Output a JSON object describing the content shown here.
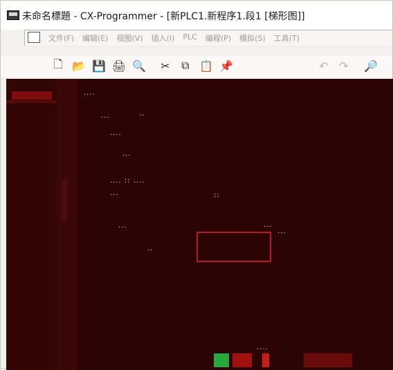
{
  "window": {
    "title": "未命名標題 - CX-Programmer - [新PLC1.新程序1.段1 [梯形图]]",
    "app_icon": "ladder-app-icon"
  },
  "menubar": {
    "items": [
      "文件(F)",
      "编辑(E)",
      "视图(V)",
      "插入(I)",
      "PLC",
      "编程(P)",
      "模拟(S)",
      "工具(T)"
    ]
  },
  "toolbar": {
    "buttons": [
      {
        "name": "new-icon",
        "glyph": "🗋"
      },
      {
        "name": "open-icon",
        "glyph": "📂"
      },
      {
        "name": "save-icon",
        "glyph": "💾"
      },
      {
        "name": "print-icon",
        "glyph": "🖨"
      },
      {
        "name": "preview-icon",
        "glyph": "🔍"
      },
      {
        "name": "cut-icon",
        "glyph": "✂"
      },
      {
        "name": "copy-icon",
        "glyph": "⧉"
      },
      {
        "name": "paste-icon",
        "glyph": "📋"
      },
      {
        "name": "paste-special-icon",
        "glyph": "📌"
      },
      {
        "name": "undo-icon",
        "glyph": "↶"
      },
      {
        "name": "redo-icon",
        "glyph": "↷"
      },
      {
        "name": "find-icon",
        "glyph": "🔎"
      }
    ]
  },
  "colors": {
    "workspace_bg": "#2d0505",
    "cursor": "#b71c1c"
  },
  "workspace": {
    "dots": [
      "....",
      "...",
      "..",
      "....",
      "...",
      ".... ::  ....",
      "...",
      "::",
      "...",
      "...",
      "...",
      "..",
      "...."
    ]
  }
}
